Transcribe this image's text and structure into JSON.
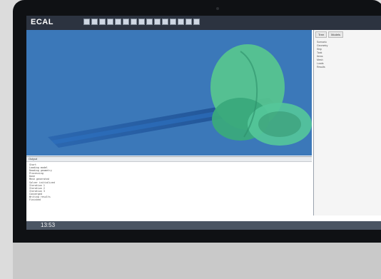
{
  "app": {
    "logo_text": "ECAL"
  },
  "right_panel": {
    "tabs": [
      "Tree",
      "Models"
    ],
    "tree_items": [
      "Scenario",
      "  Geometry",
      "    Ship",
      "    Tank",
      "  Items",
      "  Mesh",
      "  Loads",
      "  Results"
    ]
  },
  "log": {
    "header": "Output",
    "lines": [
      "Start",
      "Loading model",
      "Reading geometry",
      "Processing",
      "Done",
      "Mesh generated",
      "Solver initialized",
      "Iteration 1",
      "Iteration 2",
      "Iteration 3",
      "Converged",
      "Writing results",
      "Finished"
    ]
  },
  "status": {
    "clock": "13:53"
  }
}
